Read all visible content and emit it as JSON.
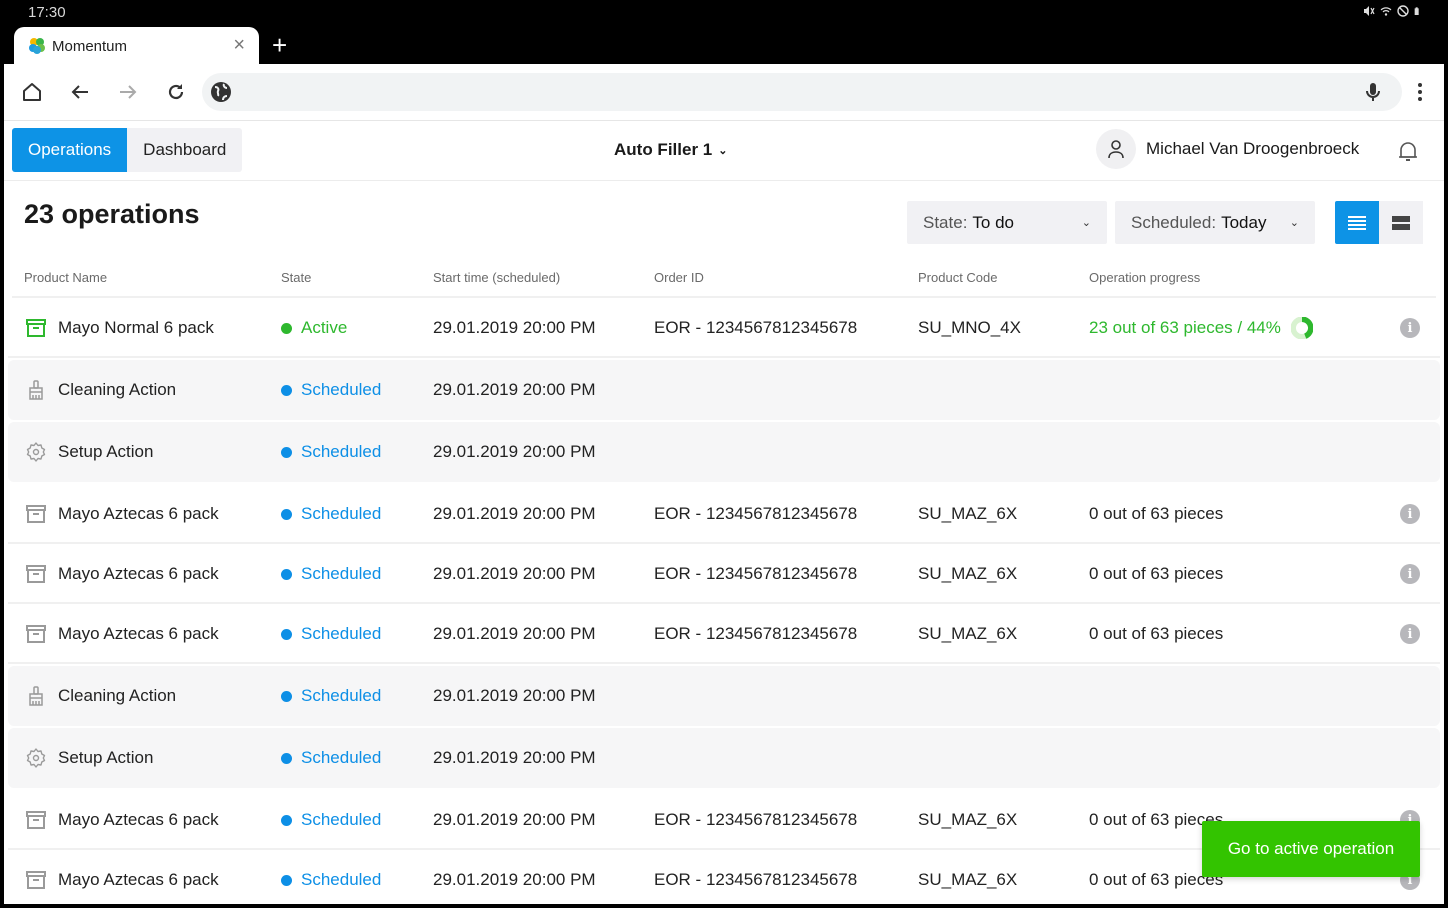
{
  "status_bar": {
    "time": "17:30",
    "icons": [
      "mute-icon",
      "wifi-icon",
      "dnd-icon",
      "battery-icon"
    ]
  },
  "browser": {
    "tab_title": "Momentum",
    "url": "",
    "buttons": [
      "home",
      "back",
      "forward",
      "reload"
    ]
  },
  "app": {
    "nav_tabs": [
      {
        "label": "Operations",
        "active": true
      },
      {
        "label": "Dashboard",
        "active": false
      }
    ],
    "machine_selector": "Auto Filler 1",
    "user_name": "Michael Van Droogenbroeck",
    "heading": "23 operations",
    "filters": {
      "state": {
        "label": "State:",
        "value": "To do"
      },
      "scheduled": {
        "label": "Scheduled:",
        "value": "Today"
      }
    },
    "view_modes": [
      {
        "name": "list",
        "active": true
      },
      {
        "name": "cards",
        "active": false
      }
    ],
    "columns": [
      "Product Name",
      "State",
      "Start time (scheduled)",
      "Order ID",
      "Product Code",
      "Operation progress"
    ],
    "rows": [
      {
        "type": "product",
        "icon": "box-icon",
        "name": "Mayo Normal 6 pack",
        "state": "Active",
        "start": "29.01.2019 20:00 PM",
        "order": "EOR - 1234567812345678",
        "code": "SU_MNO_4X",
        "progress": "23 out of 63 pieces / 44%",
        "progress_fraction": 0.44,
        "info": true
      },
      {
        "type": "action",
        "icon": "cleaning-icon",
        "name": "Cleaning Action",
        "state": "Scheduled",
        "start": "29.01.2019 20:00 PM",
        "order": "",
        "code": "",
        "progress": "",
        "info": false
      },
      {
        "type": "action",
        "icon": "setup-gear-icon",
        "name": "Setup Action",
        "state": "Scheduled",
        "start": "29.01.2019 20:00 PM",
        "order": "",
        "code": "",
        "progress": "",
        "info": false
      },
      {
        "type": "product",
        "icon": "box-icon",
        "name": "Mayo Aztecas 6 pack",
        "state": "Scheduled",
        "start": "29.01.2019 20:00 PM",
        "order": "EOR - 1234567812345678",
        "code": "SU_MAZ_6X",
        "progress": "0 out of 63 pieces",
        "info": true
      },
      {
        "type": "product",
        "icon": "box-icon",
        "name": "Mayo Aztecas 6 pack",
        "state": "Scheduled",
        "start": "29.01.2019 20:00 PM",
        "order": "EOR - 1234567812345678",
        "code": "SU_MAZ_6X",
        "progress": "0 out of 63 pieces",
        "info": true
      },
      {
        "type": "product",
        "icon": "box-icon",
        "name": "Mayo Aztecas 6 pack",
        "state": "Scheduled",
        "start": "29.01.2019 20:00 PM",
        "order": "EOR - 1234567812345678",
        "code": "SU_MAZ_6X",
        "progress": "0 out of 63 pieces",
        "info": true
      },
      {
        "type": "action",
        "icon": "cleaning-icon",
        "name": "Cleaning Action",
        "state": "Scheduled",
        "start": "29.01.2019 20:00 PM",
        "order": "",
        "code": "",
        "progress": "",
        "info": false
      },
      {
        "type": "action",
        "icon": "setup-gear-icon",
        "name": "Setup Action",
        "state": "Scheduled",
        "start": "29.01.2019 20:00 PM",
        "order": "",
        "code": "",
        "progress": "",
        "info": false
      },
      {
        "type": "product",
        "icon": "box-icon",
        "name": "Mayo Aztecas 6 pack",
        "state": "Scheduled",
        "start": "29.01.2019 20:00 PM",
        "order": "EOR - 1234567812345678",
        "code": "SU_MAZ_6X",
        "progress": "0 out of 63 pieces",
        "info": true
      },
      {
        "type": "product",
        "icon": "box-icon",
        "name": "Mayo Aztecas 6 pack",
        "state": "Scheduled",
        "start": "29.01.2019 20:00 PM",
        "order": "EOR - 1234567812345678",
        "code": "SU_MAZ_6X",
        "progress": "0 out of 63 pieces",
        "info": true
      }
    ],
    "goto_button": "Go to active operation",
    "colors": {
      "primary": "#0d93e6",
      "active_green": "#2eb82e",
      "scheduled_blue": "#0d8fe6",
      "button_green": "#33c400",
      "icon_grey": "#9a9a9a"
    }
  }
}
